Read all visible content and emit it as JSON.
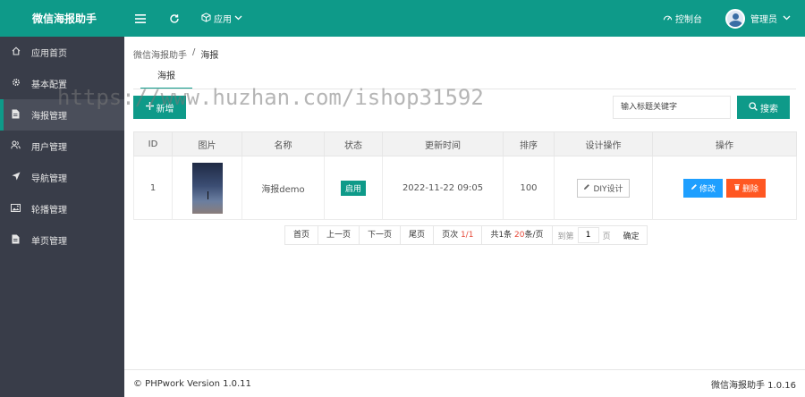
{
  "header": {
    "brand": "微信海报助手",
    "apps_label": "应用",
    "console_label": "控制台",
    "user_label": "管理员"
  },
  "sidebar": {
    "items": [
      {
        "label": "应用首页",
        "icon": "home-icon"
      },
      {
        "label": "基本配置",
        "icon": "gear-icon"
      },
      {
        "label": "海报管理",
        "icon": "file-icon",
        "active": true
      },
      {
        "label": "用户管理",
        "icon": "users-icon"
      },
      {
        "label": "导航管理",
        "icon": "navigation-icon"
      },
      {
        "label": "轮播管理",
        "icon": "image-icon"
      },
      {
        "label": "单页管理",
        "icon": "file-icon"
      }
    ]
  },
  "breadcrumb": {
    "root": "微信海报助手",
    "sep": "/",
    "current": "海报"
  },
  "tab": {
    "label": "海报"
  },
  "toolbar": {
    "add_label": "新增",
    "search_placeholder": "输入标题关键字",
    "search_label": "搜索"
  },
  "table": {
    "headers": [
      "ID",
      "图片",
      "名称",
      "状态",
      "更新时间",
      "排序",
      "设计操作",
      "操作"
    ],
    "rows": [
      {
        "id": "1",
        "name": "海报demo",
        "status": "启用",
        "updated": "2022-11-22 09:05",
        "sort": "100",
        "design_label": "DIY设计",
        "edit_label": "修改",
        "delete_label": "删除"
      }
    ]
  },
  "pager": {
    "first": "首页",
    "prev": "上一页",
    "next": "下一页",
    "last": "尾页",
    "page_prefix": "页次",
    "page_current": "1/1",
    "total_prefix": "共1条",
    "per_page": "20",
    "per_page_suffix": "条/页",
    "goto_label": "到第",
    "goto_value": "1",
    "goto_suffix": "页",
    "confirm": "确定"
  },
  "footer": {
    "left": "© PHPwork Version 1.0.11",
    "right": "微信海报助手 1.0.16"
  },
  "watermark": "https://www.huzhan.com/ishop31592",
  "colors": {
    "primary": "#0e9a89",
    "sidebar": "#393d49",
    "edit": "#1e9fff",
    "delete": "#ff5722"
  }
}
